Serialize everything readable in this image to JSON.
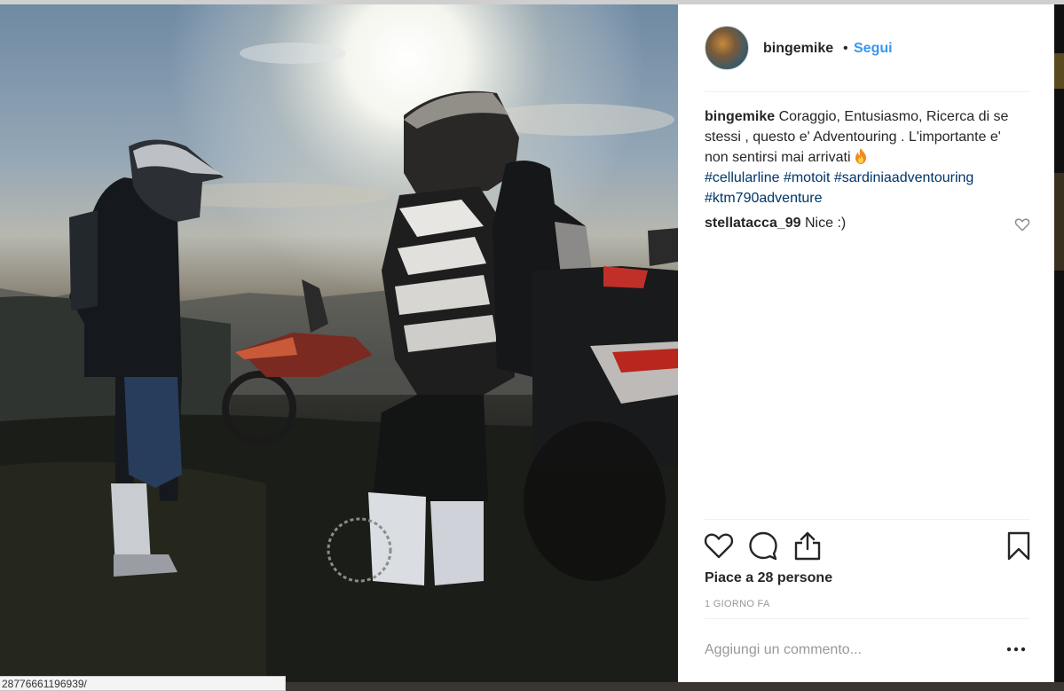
{
  "post": {
    "username": "bingemike",
    "separator": "•",
    "follow_label": "Segui",
    "caption_user": "bingemike",
    "caption_text": "Coraggio, Entusiasmo, Ricerca di se stessi , questo e' Adventouring . L'importante e' non sentirsi mai arrivati",
    "hashtags": [
      "#cellularline",
      "#motoit",
      "#sardiniaadventouring",
      "#ktm790adventure"
    ],
    "comments": [
      {
        "user": "stellatacca_99",
        "text": "Nice :)"
      }
    ],
    "likes_text": "Piace a 28 persone",
    "timestamp": "1 GIORNO FA",
    "add_comment_placeholder": "Aggiungi un commento...",
    "more_label": "•••"
  },
  "status_bar": {
    "url_fragment": "28776661196939/"
  },
  "icons": {
    "like": "heart-icon",
    "comment": "comment-bubble-icon",
    "share": "share-icon",
    "save": "bookmark-icon",
    "comment_like": "small-heart-icon",
    "flame": "fire-emoji-icon"
  },
  "colors": {
    "link_blue": "#3897f0",
    "hashtag": "#003569",
    "text": "#262626",
    "muted": "#999999"
  }
}
